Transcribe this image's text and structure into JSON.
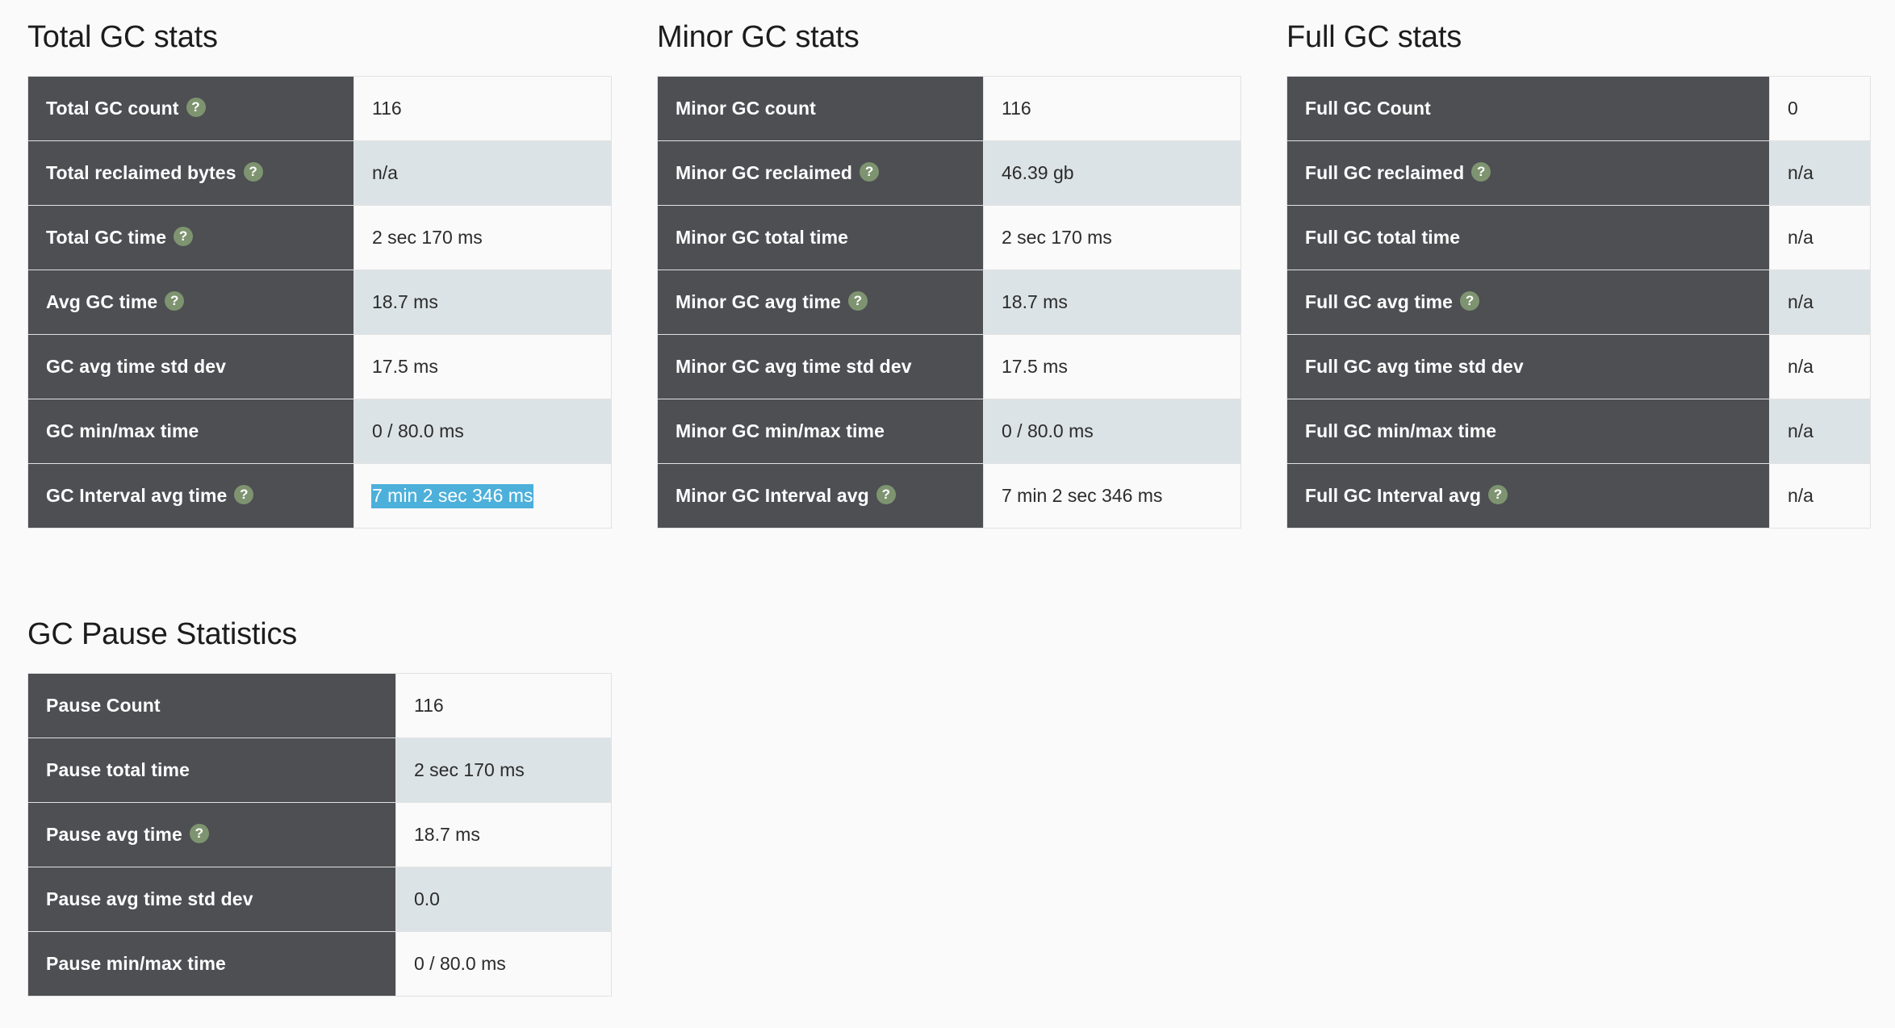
{
  "page": {
    "background_color": "#fafafa",
    "label_cell_color": "#4d4f53",
    "alt_row_color": "#dce3e6",
    "help_icon_color": "#7e9470",
    "selection_highlight_color": "#4cb0da",
    "help_icon_name": "help-icon",
    "help_icon_glyph": "?"
  },
  "panels": {
    "total": {
      "title": "Total GC stats",
      "rows": [
        {
          "label": "Total GC count",
          "help": true,
          "value": "116",
          "selected": false
        },
        {
          "label": "Total reclaimed bytes",
          "help": true,
          "value": "n/a",
          "selected": false
        },
        {
          "label": "Total GC time",
          "help": true,
          "value": "2 sec 170 ms",
          "selected": false
        },
        {
          "label": "Avg GC time",
          "help": true,
          "value": "18.7 ms",
          "selected": false
        },
        {
          "label": "GC avg time std dev",
          "help": false,
          "value": "17.5 ms",
          "selected": false
        },
        {
          "label": "GC min/max time",
          "help": false,
          "value": "0 / 80.0 ms",
          "selected": false
        },
        {
          "label": "GC Interval avg time",
          "help": true,
          "value": "7 min 2 sec 346 ms",
          "selected": true
        }
      ]
    },
    "minor": {
      "title": "Minor GC stats",
      "rows": [
        {
          "label": "Minor GC count",
          "help": false,
          "value": "116",
          "selected": false
        },
        {
          "label": "Minor GC reclaimed",
          "help": true,
          "value": "46.39 gb",
          "selected": false
        },
        {
          "label": "Minor GC total time",
          "help": false,
          "value": "2 sec 170 ms",
          "selected": false
        },
        {
          "label": "Minor GC avg time",
          "help": true,
          "value": "18.7 ms",
          "selected": false
        },
        {
          "label": "Minor GC avg time std dev",
          "help": false,
          "value": "17.5 ms",
          "selected": false
        },
        {
          "label": "Minor GC min/max time",
          "help": false,
          "value": "0 / 80.0 ms",
          "selected": false
        },
        {
          "label": "Minor GC Interval avg",
          "help": true,
          "value": "7 min 2 sec 346 ms",
          "selected": false
        }
      ]
    },
    "full": {
      "title": "Full GC stats",
      "rows": [
        {
          "label": "Full GC Count",
          "help": false,
          "value": "0",
          "selected": false
        },
        {
          "label": "Full GC reclaimed",
          "help": true,
          "value": "n/a",
          "selected": false
        },
        {
          "label": "Full GC total time",
          "help": false,
          "value": "n/a",
          "selected": false
        },
        {
          "label": "Full GC avg time",
          "help": true,
          "value": "n/a",
          "selected": false
        },
        {
          "label": "Full GC avg time std dev",
          "help": false,
          "value": "n/a",
          "selected": false
        },
        {
          "label": "Full GC min/max time",
          "help": false,
          "value": "n/a",
          "selected": false
        },
        {
          "label": "Full GC Interval avg",
          "help": true,
          "value": "n/a",
          "selected": false
        }
      ]
    },
    "pause": {
      "title": "GC Pause Statistics",
      "rows": [
        {
          "label": "Pause Count",
          "help": false,
          "value": "116",
          "selected": false
        },
        {
          "label": "Pause total time",
          "help": false,
          "value": "2 sec 170 ms",
          "selected": false
        },
        {
          "label": "Pause avg time",
          "help": true,
          "value": "18.7 ms",
          "selected": false
        },
        {
          "label": "Pause avg time std dev",
          "help": false,
          "value": "0.0",
          "selected": false
        },
        {
          "label": "Pause min/max time",
          "help": false,
          "value": "0 / 80.0 ms",
          "selected": false
        }
      ]
    }
  }
}
